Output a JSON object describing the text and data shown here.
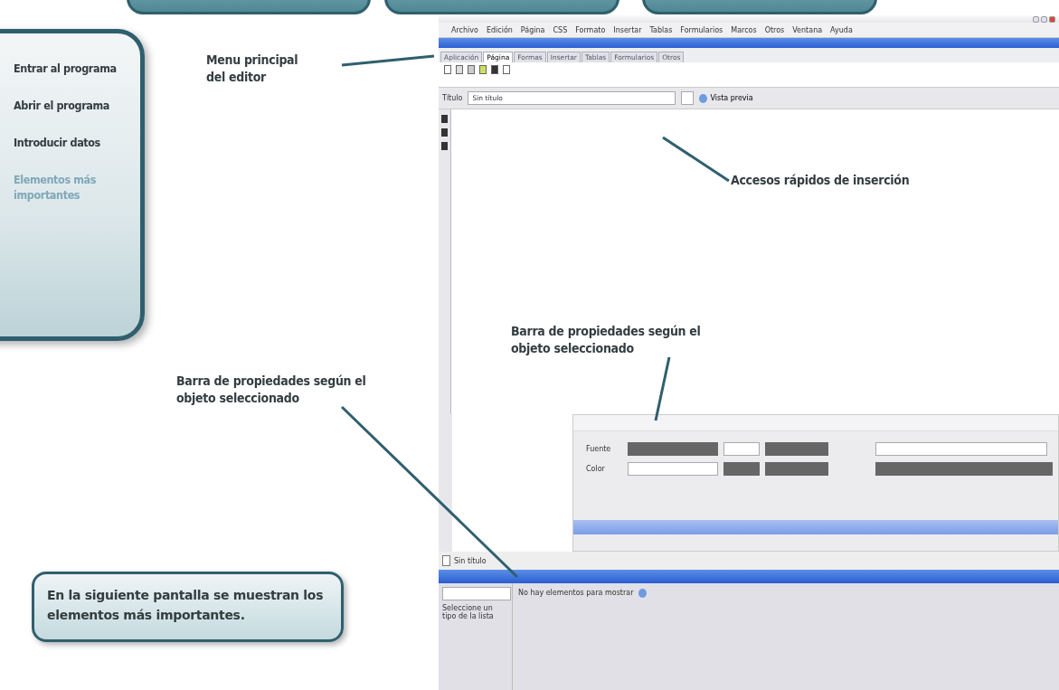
{
  "nav": {
    "items": [
      {
        "label": "Entrar al programa",
        "selected": false
      },
      {
        "label": "Abrir el programa",
        "selected": false
      },
      {
        "label": "Introducir datos",
        "selected": false
      },
      {
        "label": "Elementos más importantes",
        "selected": true
      }
    ]
  },
  "annotations": [
    {
      "text": "Menu principal del editor"
    },
    {
      "text": "Accesos rápidos de inserción"
    },
    {
      "text": "Barra de propiedades según el objeto seleccionado"
    },
    {
      "text": "Barra de propiedades según el objeto seleccionado"
    }
  ],
  "callout": {
    "text": "En la siguiente pantalla se muestran los elementos más importantes."
  },
  "editor": {
    "menu": [
      "Archivo",
      "Edición",
      "Página",
      "CSS",
      "Formato",
      "Insertar",
      "Tablas",
      "Formularios",
      "Marcos",
      "Otros",
      "Ventana",
      "Ayuda"
    ],
    "tabs": [
      {
        "label": "Aplicación",
        "selected": false
      },
      {
        "label": "Página",
        "selected": true
      },
      {
        "label": "Formas",
        "selected": false
      },
      {
        "label": "Insertar",
        "selected": false
      },
      {
        "label": "Tablas",
        "selected": false
      },
      {
        "label": "Formularios",
        "selected": false
      },
      {
        "label": "Otros",
        "selected": false
      }
    ],
    "title_label": "Título",
    "title_value": "Sin título",
    "preview": "Vista previa",
    "properties": {
      "labels": [
        "Fuente",
        "Color"
      ]
    },
    "status_doc": "Sin título",
    "bottom": {
      "hint": "Seleccione un tipo de la lista",
      "empty": "No hay elementos para mostrar"
    }
  }
}
